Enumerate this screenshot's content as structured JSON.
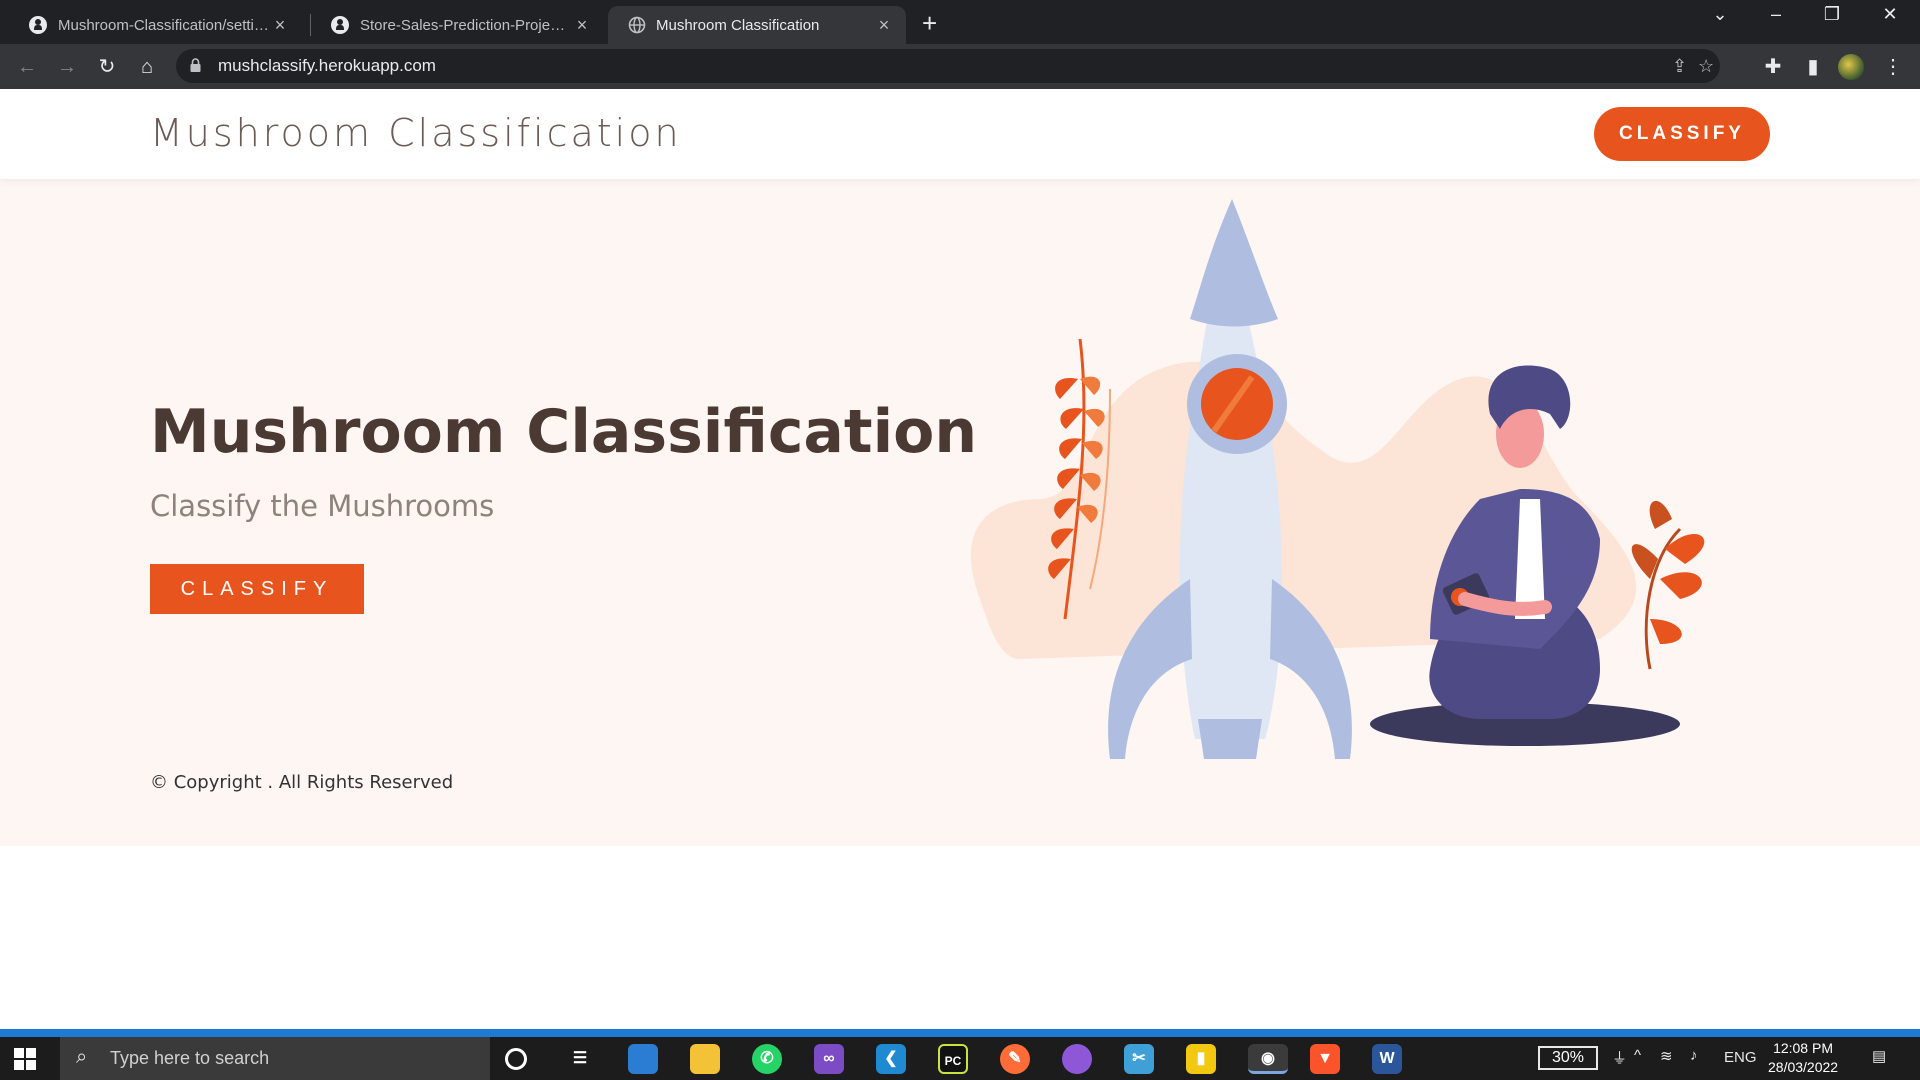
{
  "browser": {
    "tabs": [
      {
        "title": "Mushroom-Classification/settings",
        "icon": "github-icon",
        "active": false
      },
      {
        "title": "Store-Sales-Prediction-Project/D",
        "icon": "github-icon",
        "active": false
      },
      {
        "title": "Mushroom Classification",
        "icon": "globe-icon",
        "active": true
      }
    ],
    "url": "mushclassify.herokuapp.com"
  },
  "navbar": {
    "brand": "Mushroom Classification",
    "cta": "CLASSIFY"
  },
  "hero": {
    "title": "Mushroom Classification",
    "subtitle": "Classify the Mushrooms",
    "button": "CLASSIFY",
    "copyright": "© Copyright . All Rights Reserved"
  },
  "colors": {
    "accent": "#e8541d",
    "hero_bg": "#fdf6f3",
    "title": "#4b3a33",
    "chrome_dark": "#202124"
  },
  "taskbar": {
    "search_placeholder": "Type here to search",
    "battery": "30%",
    "language": "ENG",
    "time": "12:08 PM",
    "date": "28/03/2022",
    "apps": [
      "cortana-icon",
      "task-view-icon",
      "cloud-app-icon",
      "file-explorer-icon",
      "whatsapp-icon",
      "visual-studio-icon",
      "vscode-icon",
      "pycharm-icon",
      "postman-icon",
      "github-desktop-icon",
      "snipping-icon",
      "power-bi-icon",
      "chrome-icon",
      "brave-icon",
      "word-icon"
    ]
  }
}
